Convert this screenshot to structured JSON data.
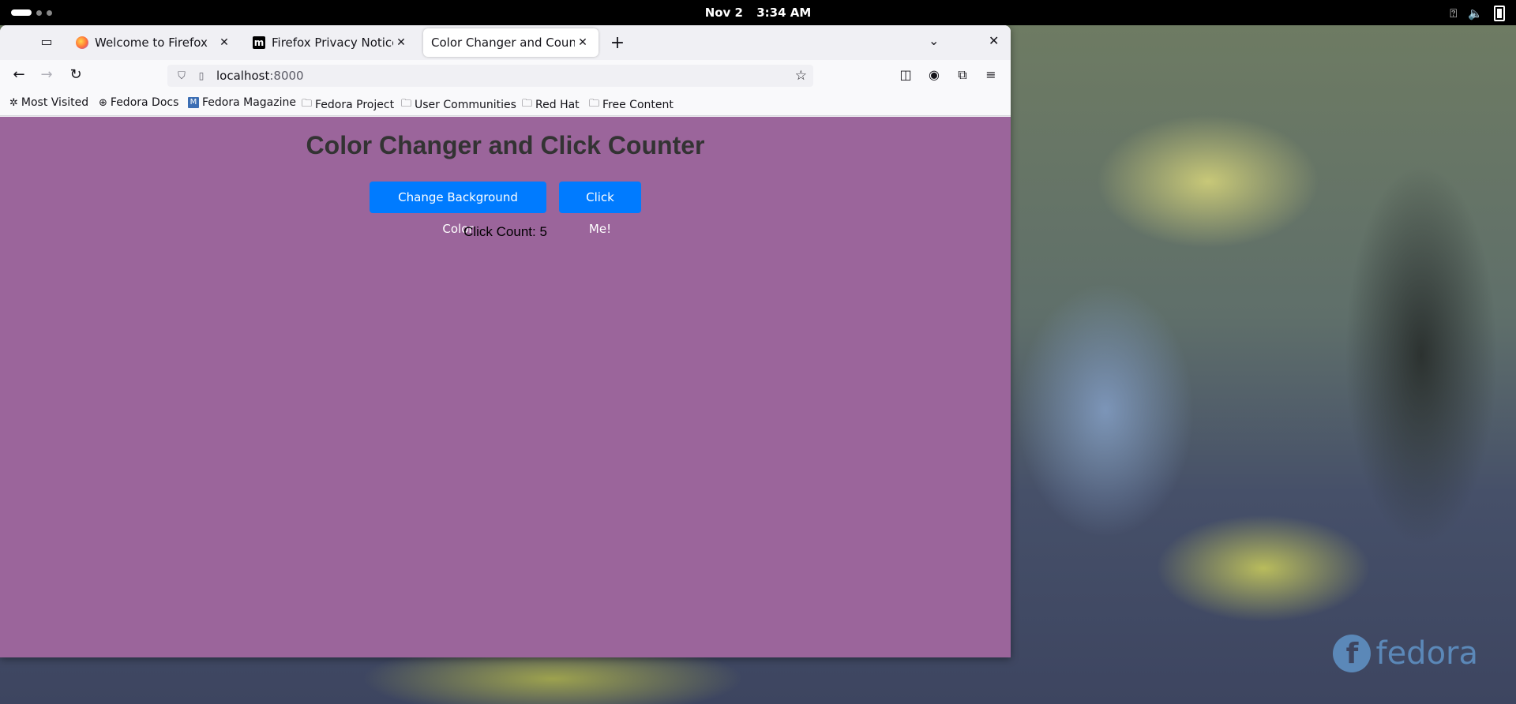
{
  "system": {
    "date": "Nov 2",
    "time": "3:34 AM",
    "wallpaper_logo": "fedora"
  },
  "browser": {
    "tabs": [
      {
        "title": "Welcome to Firefox",
        "icon": "firefox-icon",
        "active": false
      },
      {
        "title": "Firefox Privacy Notice — M",
        "icon": "mozilla-icon",
        "active": false
      },
      {
        "title": "Color Changer and Counter",
        "icon": "none",
        "active": true
      }
    ],
    "url": {
      "host": "localhost",
      "port": ":8000"
    },
    "bookmarks": [
      {
        "label": "Most Visited",
        "icon": "gear-icon"
      },
      {
        "label": "Fedora Docs",
        "icon": "globe-icon"
      },
      {
        "label": "Fedora Magazine",
        "icon": "fedora-magazine-icon"
      },
      {
        "label": "Fedora Project",
        "icon": "folder-icon"
      },
      {
        "label": "User Communities",
        "icon": "folder-icon"
      },
      {
        "label": "Red Hat",
        "icon": "folder-icon"
      },
      {
        "label": "Free Content",
        "icon": "folder-icon"
      }
    ]
  },
  "page": {
    "heading": "Color Changer and Click Counter",
    "change_color_button": "Change Background Color",
    "click_button": "Click Me!",
    "click_count_text": "Click Count: 5",
    "background_color": "#9b659b",
    "button_color": "#007bff"
  }
}
